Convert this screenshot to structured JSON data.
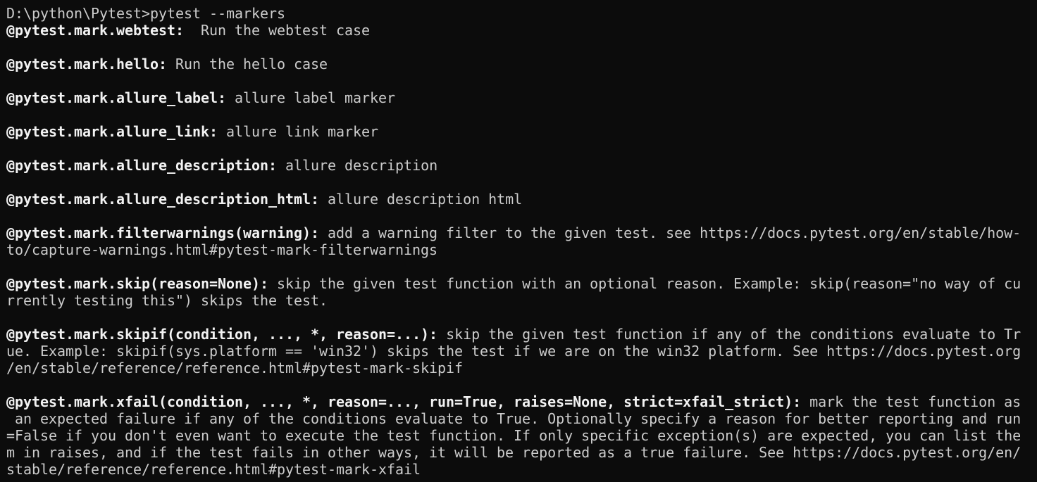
{
  "theme": {
    "background": "#0c0c0c",
    "text": "#cccccc",
    "marker_text": "#f2f2f2"
  },
  "terminal": {
    "prompt": "D:\\python\\Pytest>",
    "command": "pytest --markers",
    "lines": [
      {
        "type": "marker",
        "marker": "@pytest.mark.webtest:",
        "text": "  Run the webtest case"
      },
      {
        "type": "blank"
      },
      {
        "type": "marker",
        "marker": "@pytest.mark.hello:",
        "text": " Run the hello case"
      },
      {
        "type": "blank"
      },
      {
        "type": "marker",
        "marker": "@pytest.mark.allure_label:",
        "text": " allure label marker"
      },
      {
        "type": "blank"
      },
      {
        "type": "marker",
        "marker": "@pytest.mark.allure_link:",
        "text": " allure link marker"
      },
      {
        "type": "blank"
      },
      {
        "type": "marker",
        "marker": "@pytest.mark.allure_description:",
        "text": " allure description"
      },
      {
        "type": "blank"
      },
      {
        "type": "marker",
        "marker": "@pytest.mark.allure_description_html:",
        "text": " allure description html"
      },
      {
        "type": "blank"
      },
      {
        "type": "marker",
        "marker": "@pytest.mark.filterwarnings(warning):",
        "text": " add a warning filter to the given test. see https://docs.pytest.org/en/stable/how-"
      },
      {
        "type": "text",
        "text": "to/capture-warnings.html#pytest-mark-filterwarnings"
      },
      {
        "type": "blank"
      },
      {
        "type": "marker",
        "marker": "@pytest.mark.skip(reason=None):",
        "text": " skip the given test function with an optional reason. Example: skip(reason=\"no way of cu"
      },
      {
        "type": "text",
        "text": "rrently testing this\") skips the test."
      },
      {
        "type": "blank"
      },
      {
        "type": "marker",
        "marker": "@pytest.mark.skipif(condition, ..., *, reason=...):",
        "text": " skip the given test function if any of the conditions evaluate to Tr"
      },
      {
        "type": "text",
        "text": "ue. Example: skipif(sys.platform == 'win32') skips the test if we are on the win32 platform. See https://docs.pytest.org"
      },
      {
        "type": "text",
        "text": "/en/stable/reference/reference.html#pytest-mark-skipif"
      },
      {
        "type": "blank"
      },
      {
        "type": "marker",
        "marker": "@pytest.mark.xfail(condition, ..., *, reason=..., run=True, raises=None, strict=xfail_strict):",
        "text": " mark the test function as"
      },
      {
        "type": "text",
        "text": " an expected failure if any of the conditions evaluate to True. Optionally specify a reason for better reporting and run"
      },
      {
        "type": "text",
        "text": "=False if you don't even want to execute the test function. If only specific exception(s) are expected, you can list the"
      },
      {
        "type": "text",
        "text": "m in raises, and if the test fails in other ways, it will be reported as a true failure. See https://docs.pytest.org/en/"
      },
      {
        "type": "text",
        "text": "stable/reference/reference.html#pytest-mark-xfail"
      }
    ]
  }
}
